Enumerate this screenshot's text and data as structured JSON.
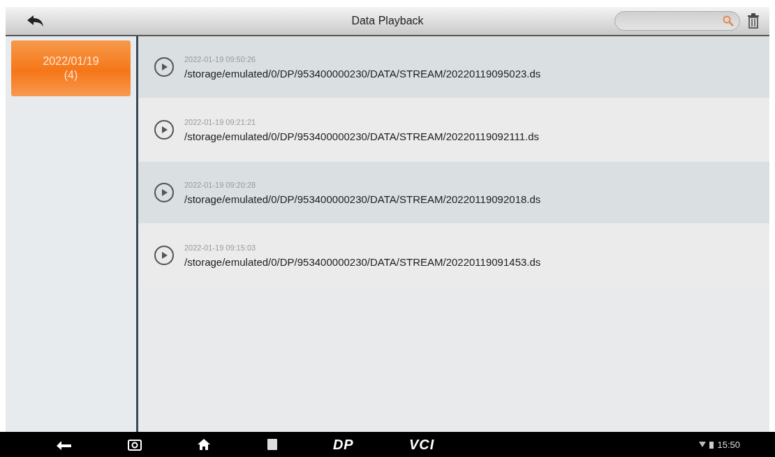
{
  "header": {
    "title": "Data Playback"
  },
  "sidebar": {
    "items": [
      {
        "date": "2022/01/19",
        "count": "(4)",
        "selected": true
      }
    ]
  },
  "records": [
    {
      "time": "2022-01-19 09:50:26",
      "path": "/storage/emulated/0/DP/953400000230/DATA/STREAM/20220119095023.ds"
    },
    {
      "time": "2022-01-19 09:21:21",
      "path": "/storage/emulated/0/DP/953400000230/DATA/STREAM/20220119092111.ds"
    },
    {
      "time": "2022-01-19 09:20:28",
      "path": "/storage/emulated/0/DP/953400000230/DATA/STREAM/20220119092018.ds"
    },
    {
      "time": "2022-01-19 09:15:03",
      "path": "/storage/emulated/0/DP/953400000230/DATA/STREAM/20220119091453.ds"
    }
  ],
  "navbar": {
    "logo_dp": "DP",
    "logo_vci": "VCI",
    "clock": "15:50"
  }
}
